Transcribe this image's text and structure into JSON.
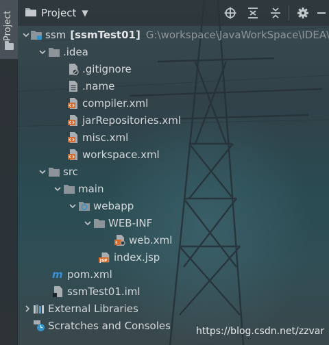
{
  "sidebar": {
    "tab_label": "Project"
  },
  "header": {
    "title": "Project",
    "caret": "▼"
  },
  "tree": {
    "root_name": "ssm",
    "root_module": "[ssmTest01]",
    "root_path": "G:\\workspace\\JavaWorkSpace\\IDEA\\s",
    "idea_folder": ".idea",
    "idea_files": [
      ".gitignore",
      ".name",
      "compiler.xml",
      "jarRepositories.xml",
      "misc.xml",
      "workspace.xml"
    ],
    "src": "src",
    "main": "main",
    "webapp": "webapp",
    "webinf": "WEB-INF",
    "web_xml": "web.xml",
    "index_jsp": "index.jsp",
    "pom": "pom.xml",
    "iml": "ssmTest01.iml",
    "external_libraries": "External Libraries",
    "scratches": "Scratches and Consoles"
  },
  "watermark": "https://blog.csdn.net/zzvar",
  "colors": {
    "folder": "#8c9499",
    "xml_badge": "#d9692a",
    "accent_blue": "#3592c4"
  }
}
